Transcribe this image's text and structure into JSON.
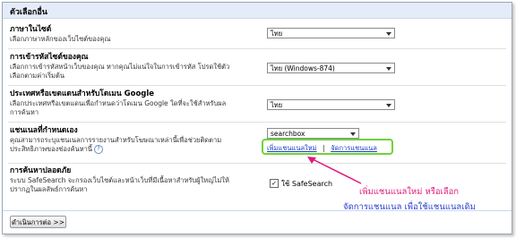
{
  "header": {
    "title": "ตัวเลือกอื่น"
  },
  "sections": {
    "language": {
      "title": "ภาษาในไซต์",
      "desc": "เลือกภาษาหลักของเว็บไซต์ของคุณ",
      "selected": "ไทย"
    },
    "encoding": {
      "title": "การเข้ารหัสไซต์ของคุณ",
      "desc_line1": "เลือกการเข้ารหัสหน้าเว็บของคุณ หากคุณไม่แน่ใจในการเข้ารหัส โปรดใช้ตัว",
      "desc_line2": "เลือกตามค่าเริ่มต้น",
      "selected": "ไทย (Windows-874)"
    },
    "country": {
      "title": "ประเทศหรือเขตแดนสำหรับโดเมน Google",
      "desc_line1": "เลือกประเทศหรือเขตแดนเพื่อกำหนดว่าโดเมน Google ใดที่จะใช้สำหรับผล",
      "desc_line2": "การค้นหา",
      "selected": "ไทย"
    },
    "channels": {
      "title": "แชนเนลที่กำหนดเอง",
      "desc_line1": "คุณสามารถระบุแชนเนลการรายงานสำหรับโฆษณาเหล่านี้เพื่อช่วยติดตาม",
      "desc_line2": "ประสิทธิภาพของช่องค้นหานี้",
      "selected": "searchbox",
      "add_link": "เพิ่มแชนแนลใหม่",
      "separator": "|",
      "manage_link": "จัดการแชนแนล"
    },
    "safesearch": {
      "title": "การค้นหาปลอดภัย",
      "desc_line1": "ระบบ SafeSearch จะกรองเว็บไซต์และหน้าเว็บที่มีเนื้อหาสำหรับผู้ใหญ่ไม่ให้",
      "desc_line2": "ปรากฏในผลลัพธ์การค้นหา",
      "checkbox_label": "ใช้ SafeSearch",
      "checked": true
    }
  },
  "annotation": {
    "line1": "เพิ่มแชนแนลใหม่  หรือเลือก",
    "line2": "จัดการแชนแนล  เพื่อใช้แชนแนลเดิม",
    "color_red": "#e0197a",
    "color_blue": "#2a3fd0"
  },
  "footer": {
    "button_label": "ดำเนินการต่อ >>"
  }
}
